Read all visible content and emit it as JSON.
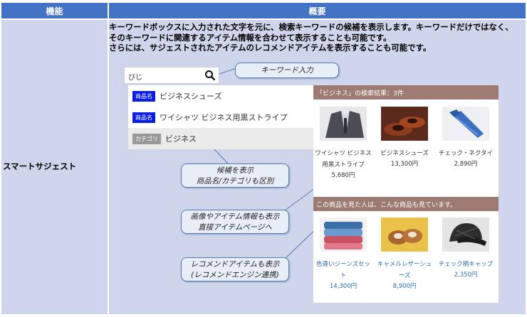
{
  "header": {
    "col1": "機能",
    "col2": "概要"
  },
  "feature": {
    "name": "スマートサジェスト"
  },
  "description": {
    "line1": "キーワードボックスに入力された文字を元に、検索キーワードの候補を表示します。キーワードだけではなく、",
    "line2": "そのキーワードに関連するアイテム情報を合わせて表示することも可能です。",
    "line3": "さらには、サジェストされたアイテムのレコメンドアイテムを表示することも可能です。"
  },
  "search": {
    "value": "びじ",
    "icon": "search-icon"
  },
  "suggestions": [
    {
      "badge": "商品名",
      "text": "ビジネスシューズ"
    },
    {
      "badge": "商品名",
      "text": "ワイシャツ ビジネス用黒ストライプ"
    },
    {
      "badge": "カテゴリ",
      "text": "ビジネス"
    }
  ],
  "callouts": {
    "keyword": "キーワード入力",
    "candidates_1": "候補を表示",
    "candidates_2": "商品名/カテゴリも区別",
    "items_1": "画像やアイテム情報も表示",
    "items_2": "直接アイテムページへ",
    "recommend_1": "レコメンドアイテムも表示",
    "recommend_2": "(レコメンドエンジン連携)"
  },
  "results": {
    "header": "「ビジネス」の検索結果：3件",
    "items": [
      {
        "name1": "ワイシャツ ビジネス",
        "name2": "用黒ストライプ",
        "price": "5,680円"
      },
      {
        "name1": "ビジネスシューズ",
        "name2": "",
        "price": "13,300円"
      },
      {
        "name1": "チェック・ネクタイ",
        "name2": "",
        "price": "2,890円"
      }
    ]
  },
  "recommend": {
    "header": "この商品を見た人は、こんな商品も見ています。",
    "items": [
      {
        "name1": "色違いジーンズセッ",
        "name2": "ト",
        "price": "14,300円"
      },
      {
        "name1": "キャメルレザーシュ",
        "name2": "ーズ",
        "price": "8,900円"
      },
      {
        "name1": "チェック柄キャップ",
        "name2": "",
        "price": "2,350円"
      }
    ]
  },
  "colors": {
    "header_bg": "#4472c4",
    "cell_bg": "#cfd5ea",
    "badge_blue": "#0a1ee6",
    "result_bar": "#9d7b72",
    "recommend_link": "#2a6fb0"
  }
}
